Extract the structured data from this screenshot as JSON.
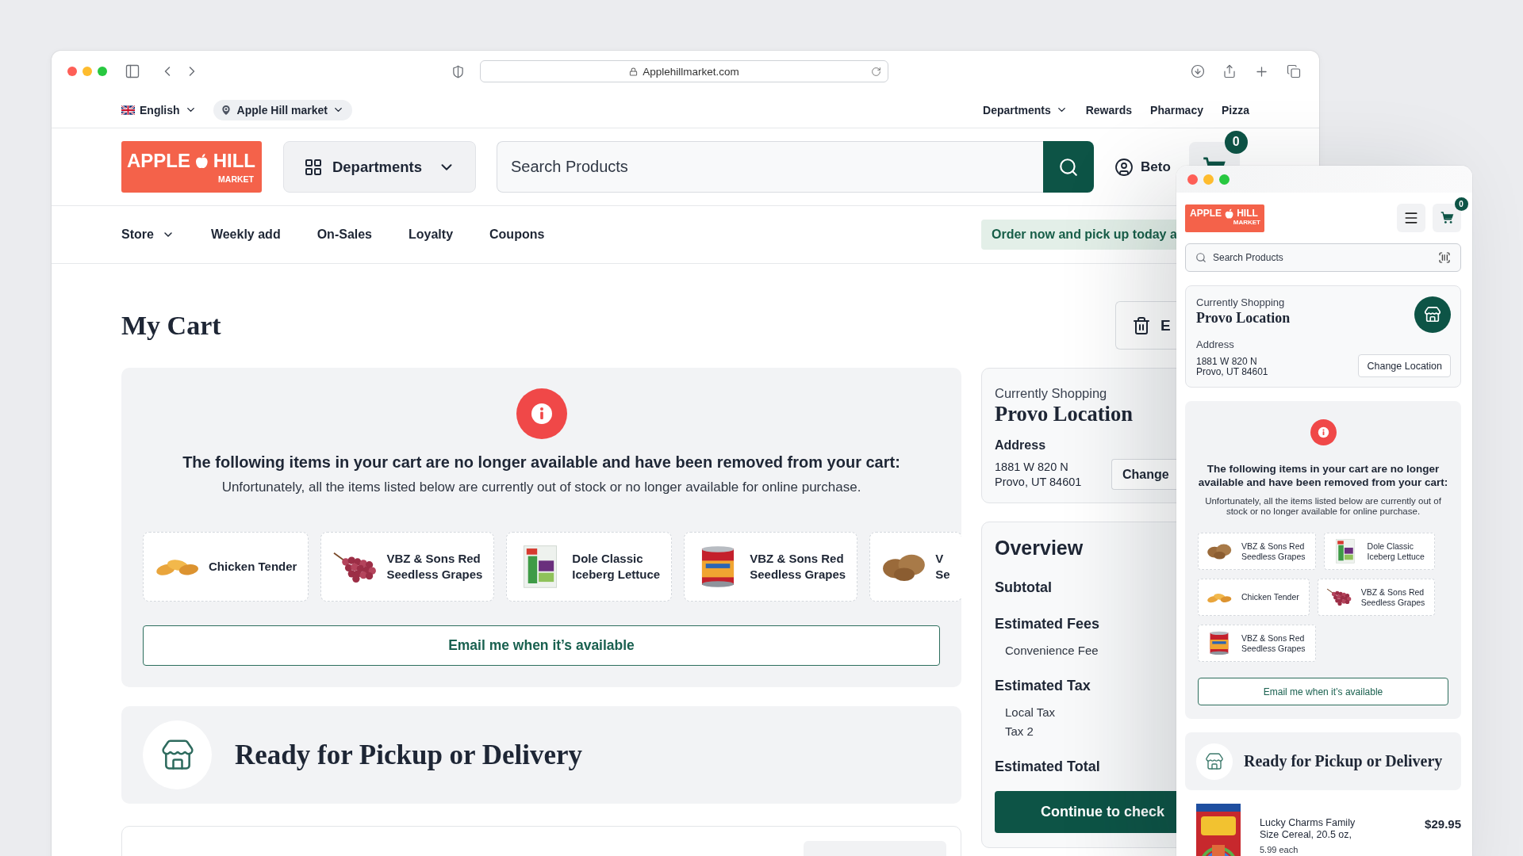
{
  "browser": {
    "url": "Applehillmarket.com"
  },
  "desktop": {
    "language": "English",
    "store_picker": "Apple Hill market",
    "top_links": [
      {
        "label": "Departments",
        "dropdown": true
      },
      {
        "label": "Rewards",
        "dropdown": false
      },
      {
        "label": "Pharmacy",
        "dropdown": false
      },
      {
        "label": "Pizza",
        "dropdown": false
      }
    ],
    "logo": {
      "word_left": "APPLE",
      "word_right": "HILL",
      "tagline": "MARKET"
    },
    "departments_button": "Departments",
    "search": {
      "placeholder": "Search Products"
    },
    "account": "Beto",
    "cart_count": "0",
    "nav": [
      {
        "label": "Store",
        "dropdown": true
      },
      {
        "label": "Weekly add",
        "dropdown": false
      },
      {
        "label": "On-Sales",
        "dropdown": false
      },
      {
        "label": "Loyalty",
        "dropdown": false
      },
      {
        "label": "Coupons",
        "dropdown": false
      }
    ],
    "promo": "Order now and pick up today a",
    "page_title": "My Cart",
    "clear_button": "E",
    "unavailable": {
      "heading": "The following items in your cart are no longer available and have been removed from your cart:",
      "message": "Unfortunately, all the items listed below are currently out of stock or no longer available for online purchase.",
      "items": [
        {
          "kind": "chicken",
          "name": [
            "Chicken Tender"
          ]
        },
        {
          "kind": "grapes",
          "name": [
            "VBZ & Sons Red",
            "Seedless Grapes"
          ]
        },
        {
          "kind": "lettuce",
          "name": [
            "Dole Classic",
            "Iceberg Lettuce"
          ]
        },
        {
          "kind": "can",
          "name": [
            "VBZ & Sons Red",
            "Seedless Grapes"
          ]
        },
        {
          "kind": "potatoes",
          "name": [
            "V",
            "Se"
          ]
        }
      ],
      "email_button": "Email me when it’s available"
    },
    "pickup": {
      "title": "Ready for Pickup or Delivery"
    },
    "location": {
      "label": "Currently Shopping",
      "name": "Provo Location",
      "address_label": "Address",
      "address": [
        "1881 W 820 N",
        "Provo, UT 84601"
      ],
      "change_button": "Change"
    },
    "overview": {
      "title": "Overview",
      "sections": [
        {
          "heading": "Subtotal"
        },
        {
          "heading": "Estimated Fees",
          "lines": [
            "Convenience Fee"
          ]
        },
        {
          "heading": "Estimated Tax",
          "lines": [
            "Local Tax",
            "Tax 2"
          ]
        },
        {
          "heading": "Estimated Total"
        }
      ],
      "checkout_button": "Continue to check"
    }
  },
  "mobile": {
    "logo": {
      "word_left": "APPLE",
      "word_right": "HILL",
      "tagline": "MARKET"
    },
    "cart_count": "0",
    "search": {
      "placeholder": "Search Products"
    },
    "location": {
      "label": "Currently Shopping",
      "name": "Provo Location",
      "address_label": "Address",
      "address": [
        "1881 W 820 N",
        "Provo, UT 84601"
      ],
      "change_button": "Change Location"
    },
    "unavailable": {
      "heading": "The following items in your cart are no longer available and have been removed from your cart:",
      "message": "Unfortunately, all the items listed below are currently out of stock or no longer available for online purchase.",
      "items": [
        {
          "kind": "potatoes",
          "name": [
            "VBZ & Sons Red",
            "Seedless Grapes"
          ]
        },
        {
          "kind": "lettuce",
          "name": [
            "Dole Classic",
            "Iceberg Lettuce"
          ]
        },
        {
          "kind": "chicken",
          "name": [
            "Chicken Tender"
          ]
        },
        {
          "kind": "grapes",
          "name": [
            "VBZ & Sons Red",
            "Seedless Grapes"
          ]
        },
        {
          "kind": "can",
          "name": [
            "VBZ & Sons Red",
            "Seedless Grapes"
          ]
        }
      ],
      "email_button": "Email me when it’s available"
    },
    "pickup": {
      "title": "Ready for Pickup or Delivery"
    },
    "cart_items": [
      {
        "kind": "cereal",
        "name": "Lucky Charms Family Size Cereal, 20.5 oz,",
        "unit_price": "5.99 each",
        "price": "$29.95"
      }
    ]
  }
}
